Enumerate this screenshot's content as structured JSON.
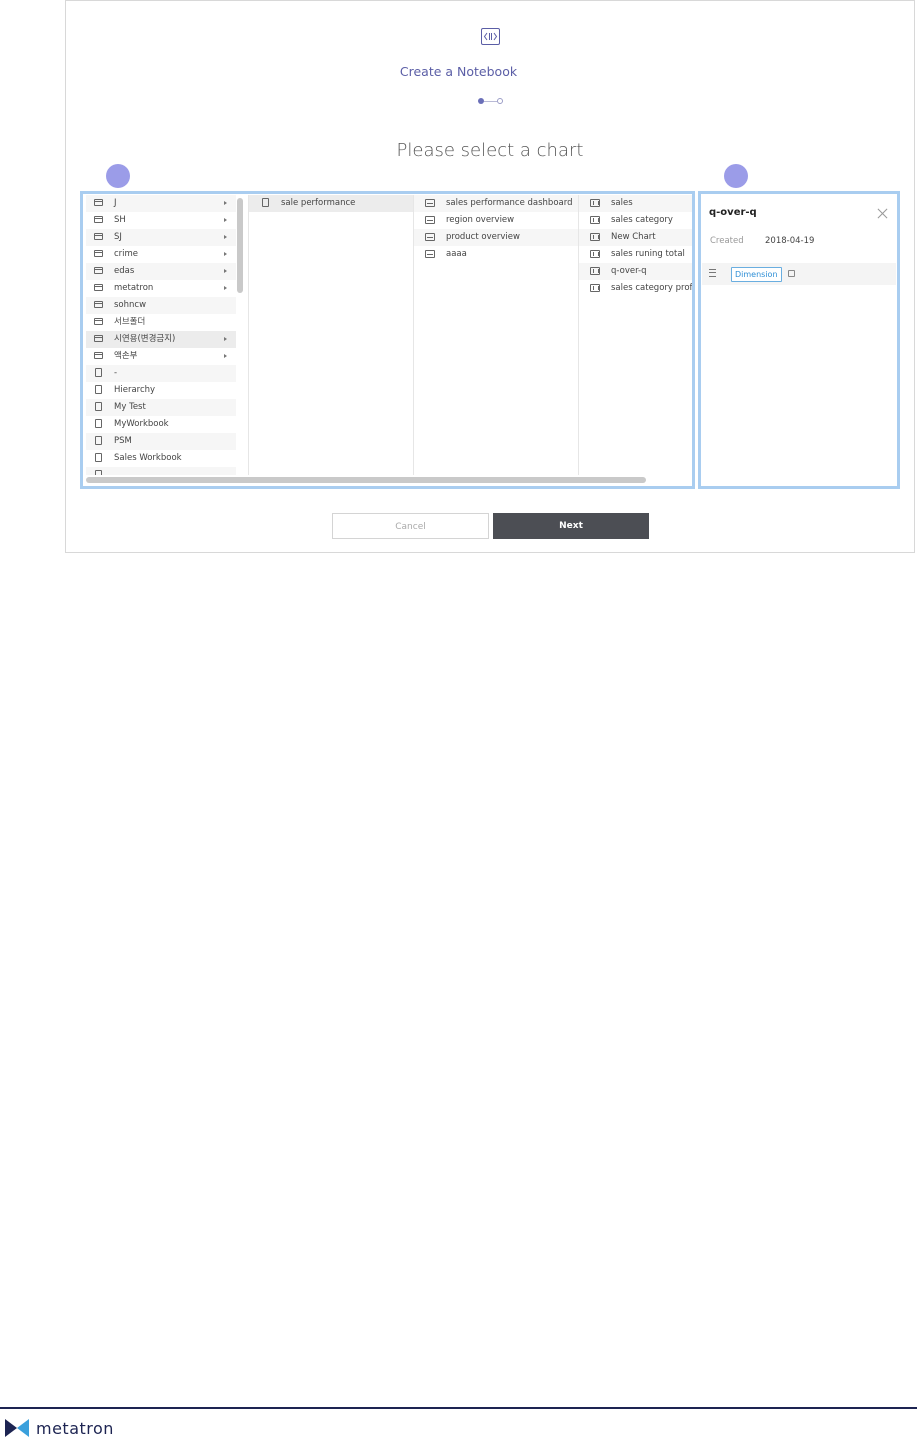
{
  "header": {
    "title": "Create a Notebook",
    "heading": "Please select a chart"
  },
  "stepper": {
    "current_step": 1,
    "total_steps": 2
  },
  "columns": {
    "folders": [
      {
        "label": "J",
        "icon": "folder-icon",
        "has_children": true
      },
      {
        "label": "SH",
        "icon": "folder-icon",
        "has_children": true
      },
      {
        "label": "SJ",
        "icon": "folder-icon",
        "has_children": true
      },
      {
        "label": "crime",
        "icon": "folder-icon",
        "has_children": true
      },
      {
        "label": "edas",
        "icon": "folder-icon",
        "has_children": true
      },
      {
        "label": "metatron",
        "icon": "folder-icon",
        "has_children": true
      },
      {
        "label": "sohncw",
        "icon": "folder-icon",
        "has_children": false
      },
      {
        "label": "서브폴더",
        "icon": "folder-icon",
        "has_children": false
      },
      {
        "label": "시연용(변경금지)",
        "icon": "folder-icon",
        "has_children": true
      },
      {
        "label": "액손부",
        "icon": "folder-icon",
        "has_children": true
      },
      {
        "label": "-",
        "icon": "workbook-icon",
        "has_children": false
      },
      {
        "label": "Hierarchy",
        "icon": "workbook-icon",
        "has_children": false
      },
      {
        "label": "My Test",
        "icon": "workbook-icon",
        "has_children": false
      },
      {
        "label": "MyWorkbook",
        "icon": "workbook-icon",
        "has_children": false
      },
      {
        "label": "PSM",
        "icon": "workbook-icon",
        "has_children": false
      },
      {
        "label": "Sales Workbook",
        "icon": "workbook-icon",
        "has_children": false
      }
    ],
    "workbooks": [
      {
        "label": "sale performance",
        "icon": "workbook-icon"
      }
    ],
    "dashboards": [
      {
        "label": "sales performance dashboard",
        "icon": "dashboard-icon"
      },
      {
        "label": "region overview",
        "icon": "dashboard-icon"
      },
      {
        "label": "product overview",
        "icon": "dashboard-icon"
      },
      {
        "label": "aaaa",
        "icon": "dashboard-icon"
      }
    ],
    "charts": [
      {
        "label": "sales",
        "icon": "bar-chart-icon"
      },
      {
        "label": "sales category",
        "icon": "bar-chart-icon"
      },
      {
        "label": "New Chart",
        "icon": "bar-chart-icon"
      },
      {
        "label": "sales runing total",
        "icon": "bar-chart-icon"
      },
      {
        "label": "q-over-q",
        "icon": "bar-chart-icon"
      },
      {
        "label": "sales category profit",
        "icon": "bar-chart-icon"
      }
    ]
  },
  "detail": {
    "title": "q-over-q",
    "created_label": "Created",
    "created_value": "2018-04-19",
    "tag": "Dimension"
  },
  "buttons": {
    "cancel": "Cancel",
    "next": "Next"
  },
  "footer": {
    "brand": "metatron",
    "brand_color": "#1d2452"
  },
  "colors": {
    "accent": "#5b5ea6",
    "highlight_border": "#a9cdf0",
    "marker": "#9b9ce8",
    "next_button": "#4c4e54"
  }
}
